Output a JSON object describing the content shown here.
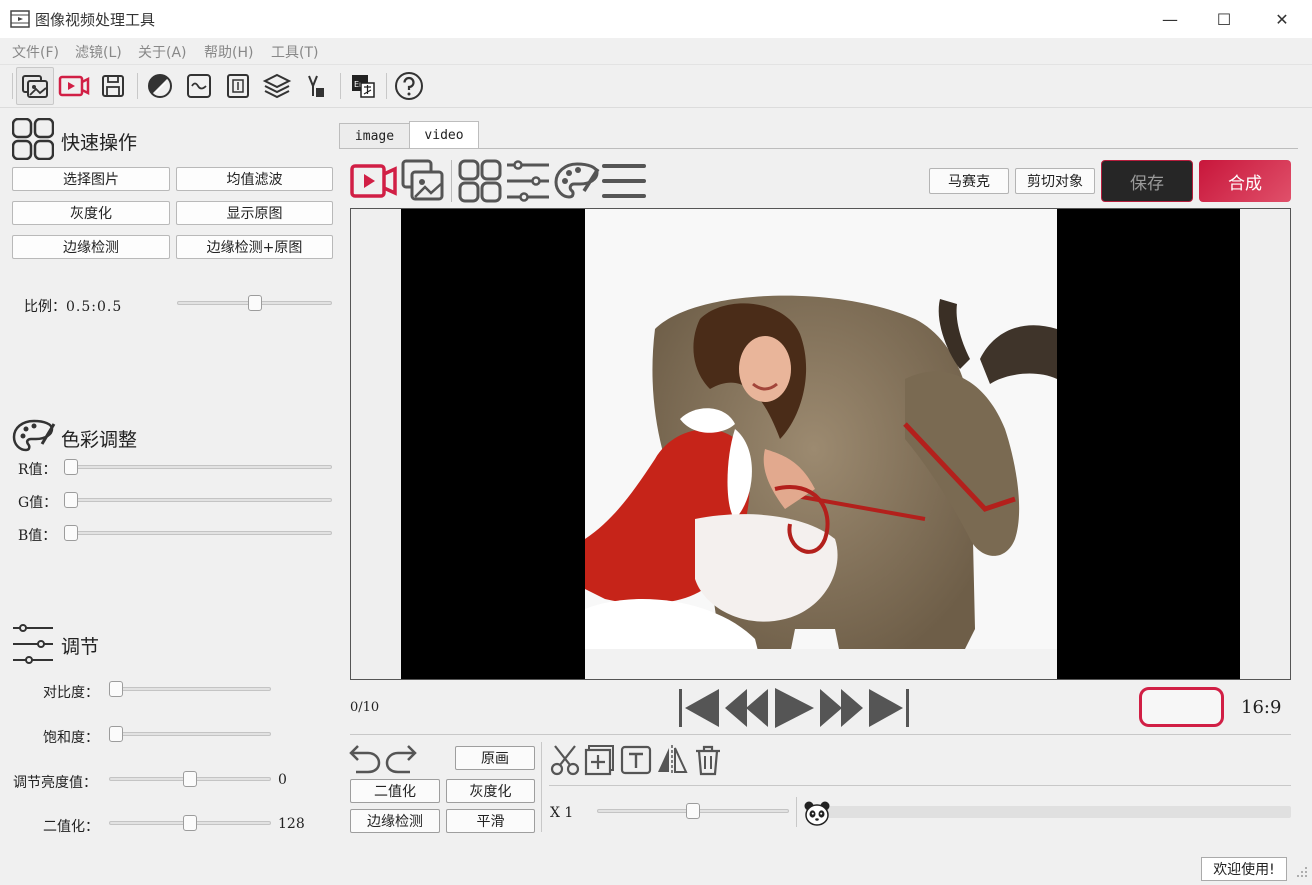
{
  "window": {
    "title": "图像视频处理工具",
    "minimize": "—",
    "maximize": "☐",
    "close": "✕"
  },
  "menu": [
    "文件(F)",
    "滤镜(L)",
    "关于(A)",
    "帮助(H)",
    "工具(T)"
  ],
  "toolbar": {
    "icons": [
      "image-window-icon",
      "video-play-icon",
      "save-disk-icon",
      "contrast-circle-icon",
      "curve-icon",
      "text-frame-icon",
      "layers-icon",
      "selection-tool-icon",
      "translate-en-icon",
      "help-icon"
    ],
    "translate_badge": "En"
  },
  "quick_ops": {
    "title": "快速操作",
    "buttons": [
      "选择图片",
      "均值滤波",
      "灰度化",
      "显示原图",
      "边缘检测",
      "边缘检测+原图"
    ],
    "ratio_label": "比例：",
    "ratio_value": "0.5:0.5",
    "ratio_slider": 0.5
  },
  "color_adjust": {
    "title": "色彩调整",
    "r_label": "R值：",
    "g_label": "G值：",
    "b_label": "B值：",
    "r": 0,
    "g": 0,
    "b": 0
  },
  "tuning": {
    "title": "调节",
    "contrast_label": "对比度：",
    "saturation_label": "饱和度：",
    "brightness_label": "调节亮度值：",
    "brightness_value": "0",
    "binarize_label": "二值化：",
    "binarize_value": "128",
    "contrast": 0,
    "saturation": 0,
    "brightness": 0.5,
    "binarize": 0.5
  },
  "tabs": [
    "image",
    "video"
  ],
  "video_panel": {
    "mosaic_button": "马赛克",
    "cut_object_button": "剪切对象",
    "save_button": "保存",
    "compose_button": "合成",
    "frame_counter": "0/10",
    "aspect_ratio": "16:9",
    "original_frame_button": "原画",
    "binarize_button": "二值化",
    "gray_button": "灰度化",
    "edge_button": "边缘检测",
    "smooth_button": "平滑",
    "speed_label": "X 1",
    "speed_slider": 0.5
  },
  "status": {
    "welcome": "欢迎使用!"
  },
  "colors": {
    "accent_red": "#d11f45",
    "dark_button": "#2a2a2a"
  }
}
